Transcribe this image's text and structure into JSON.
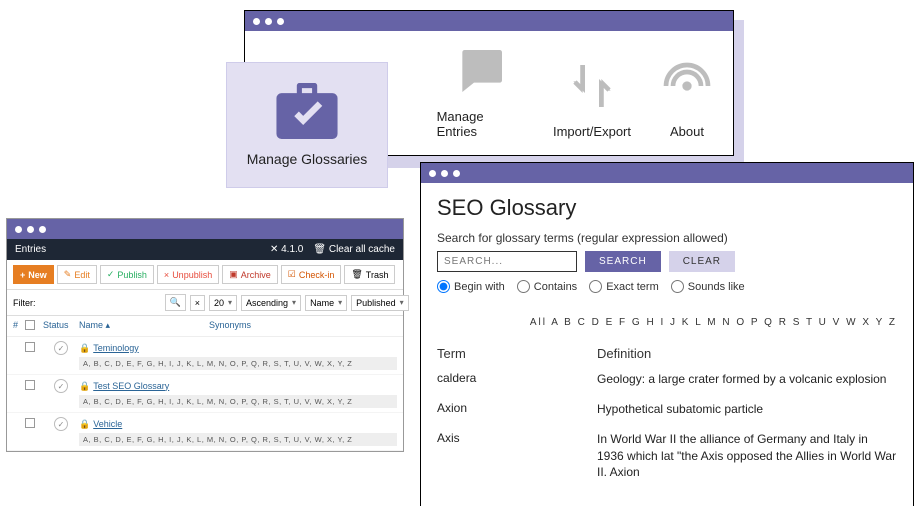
{
  "nav": {
    "items": [
      {
        "label": "Manage Glossaries"
      },
      {
        "label": "Manage Entries"
      },
      {
        "label": "Import/Export"
      },
      {
        "label": "About"
      }
    ]
  },
  "admin": {
    "header": "Entries",
    "version": "4.1.0",
    "clear_cache": "Clear all cache",
    "toolbar": {
      "new": "New",
      "edit": "Edit",
      "publish": "Publish",
      "unpublish": "Unpublish",
      "archive": "Archive",
      "checkin": "Check-in",
      "trash": "Trash"
    },
    "filter": {
      "label": "Filter:",
      "page": "20",
      "order": "Ascending",
      "sort": "Name",
      "state": "Published"
    },
    "columns": {
      "num": "#",
      "status": "Status",
      "name": "Name ▴",
      "synonyms": "Synonyms"
    },
    "alpha": "A, B, C, D, E, F, G, H, I, J, K, L, M, N, O, P, Q, R, S, T, U, V, W, X, Y, Z",
    "rows": [
      {
        "name": "Teminology"
      },
      {
        "name": "Test SEO Glossary"
      },
      {
        "name": "Vehicle"
      }
    ]
  },
  "glossary": {
    "title": "SEO Glossary",
    "help": "Search for glossary terms (regular expression allowed)",
    "search_placeholder": "SEARCH...",
    "search_btn": "SEARCH",
    "clear_btn": "CLEAR",
    "radios": {
      "begin": "Begin with",
      "contains": "Contains",
      "exact": "Exact term",
      "sounds": "Sounds like"
    },
    "alpha": "All  A  B  C  D  E  F  G  H  I  J  K  L  M  N  O  P  Q  R  S  T  U  V  W  X  Y  Z",
    "col_term": "Term",
    "col_def": "Definition",
    "entries": [
      {
        "term": "caldera",
        "def": "Geology: a large crater formed by a volcanic explosion"
      },
      {
        "term": "Axion",
        "def": "Hypothetical subatomic particle"
      },
      {
        "term": "Axis",
        "def": "In World War II the alliance of Germany and Italy in 1936 which lat \"the Axis opposed the Allies in World War II. Axion"
      }
    ]
  }
}
